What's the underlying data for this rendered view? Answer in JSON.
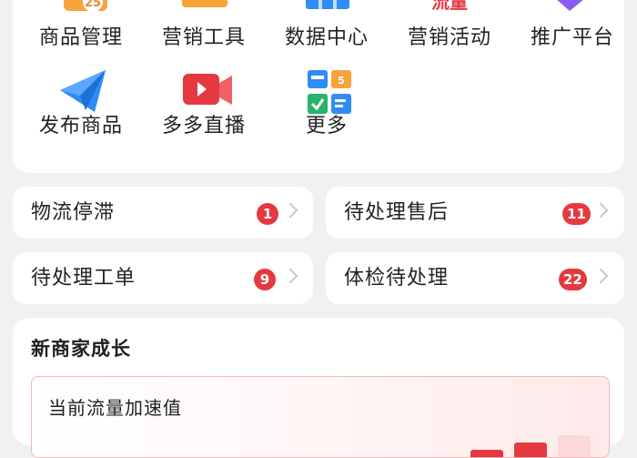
{
  "grid": {
    "row1": [
      {
        "label": "商品管理",
        "icon": "calendar-icon",
        "badge_text": "25"
      },
      {
        "label": "营销工具",
        "icon": "toolbox-icon"
      },
      {
        "label": "数据中心",
        "icon": "bar-chart-icon"
      },
      {
        "label": "营销活动",
        "icon": "traffic-icon",
        "icon_text": "流量"
      },
      {
        "label": "推广平台",
        "icon": "megaphone-icon"
      }
    ],
    "row2": [
      {
        "label": "发布商品",
        "icon": "paper-plane-icon"
      },
      {
        "label": "多多直播",
        "icon": "video-camera-icon"
      },
      {
        "label": "更多",
        "icon": "apps-grid-icon",
        "icon_text": "5"
      }
    ]
  },
  "tasks": [
    {
      "label": "物流停滞",
      "count": "1"
    },
    {
      "label": "待处理售后",
      "count": "11"
    },
    {
      "label": "待处理工单",
      "count": "9"
    },
    {
      "label": "体检待处理",
      "count": "22"
    }
  ],
  "growth": {
    "title": "新商家成长",
    "metric_label": "当前流量加速值"
  },
  "colors": {
    "accent_red": "#e5393f",
    "page_bg": "#f1f1f3",
    "card_bg": "#ffffff",
    "blue": "#2f8bf5",
    "orange": "#f7a23b"
  }
}
